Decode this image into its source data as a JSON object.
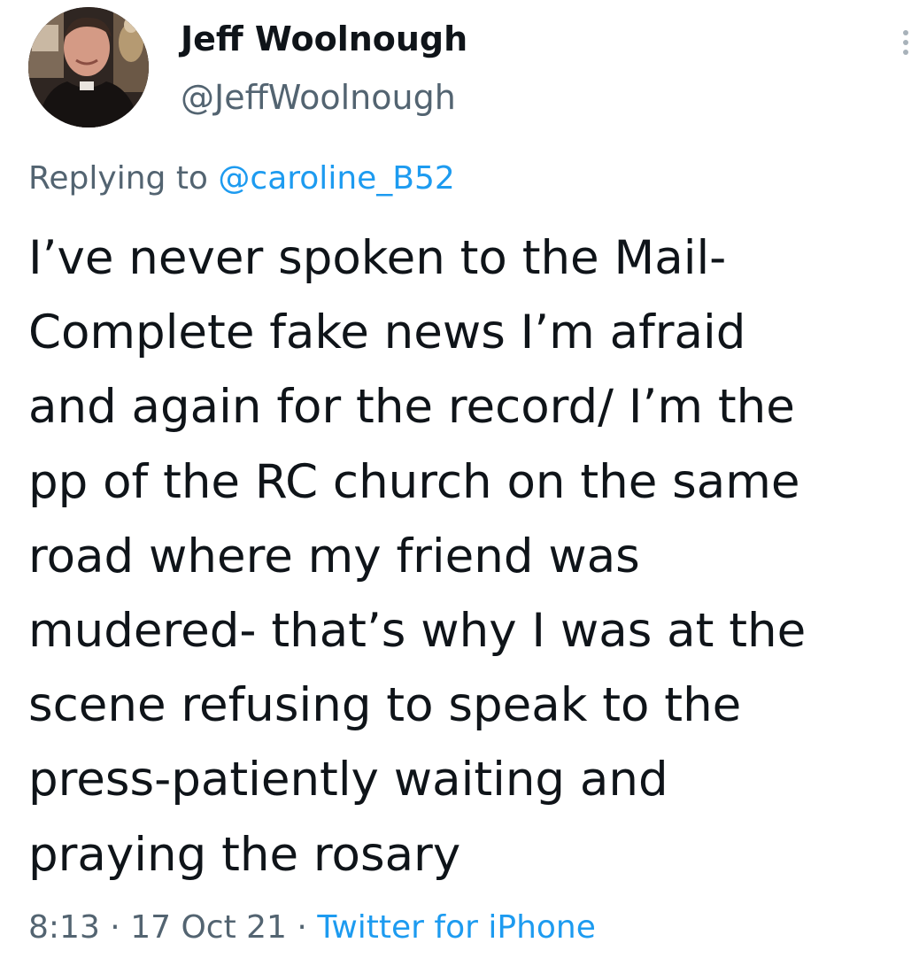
{
  "author": {
    "display_name": "Jeff Woolnough",
    "handle": "@JeffWoolnough",
    "avatar": "profile-photo"
  },
  "more_icon": "three-dots-vertical",
  "reply": {
    "prefix": "Replying to",
    "mention": "@caroline_B52"
  },
  "tweet": {
    "lines": [
      "I’ve never spoken to the Mail-",
      "Complete fake news I’m afraid",
      "and again for the record/ I’m the",
      "pp of the RC church on the same",
      "road where my friend was",
      "mudered- that’s why I was at the",
      "scene refusing to speak to the",
      "press-patiently waiting and",
      "praying the rosary"
    ]
  },
  "meta": {
    "time": "8:13",
    "separator": "·",
    "date": "17 Oct 21",
    "source": "Twitter for iPhone"
  },
  "colors": {
    "text": "#0f1419",
    "secondary": "#536471",
    "link": "#1d9bf0",
    "background": "#ffffff"
  }
}
